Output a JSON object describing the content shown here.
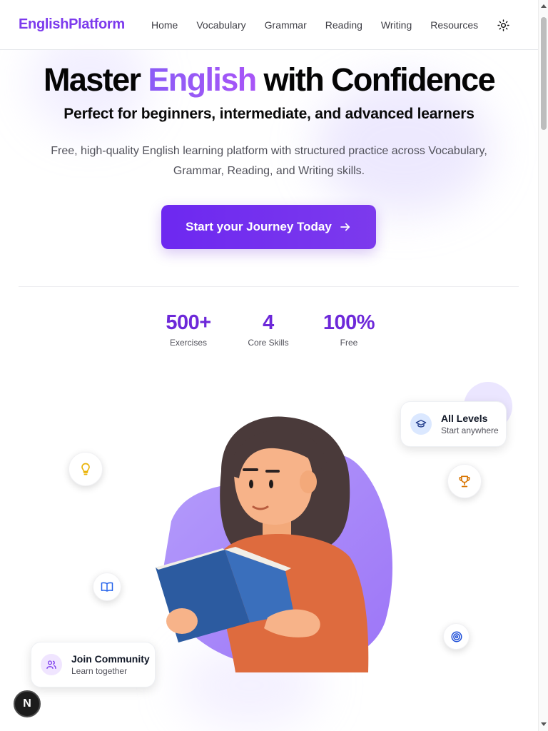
{
  "header": {
    "brand": "EnglishPlatform",
    "nav": [
      "Home",
      "Vocabulary",
      "Grammar",
      "Reading",
      "Writing",
      "Resources"
    ],
    "theme_toggle_icon": "sun-icon"
  },
  "hero": {
    "title_before": "Master ",
    "title_accent": "English",
    "title_after": " with Confidence",
    "subtitle": "Perfect for beginners, intermediate, and advanced learners",
    "description": "Free, high-quality English learning platform with structured practice across Vocabulary, Grammar, Reading, and Writing skills.",
    "cta_label": "Start your Journey Today"
  },
  "stats": [
    {
      "value": "500+",
      "label": "Exercises"
    },
    {
      "value": "4",
      "label": "Core Skills"
    },
    {
      "value": "100%",
      "label": "Free"
    }
  ],
  "floating_cards": {
    "levels": {
      "title": "All Levels",
      "subtitle": "Start anywhere",
      "icon": "graduation-cap-icon"
    },
    "community": {
      "title": "Join Community",
      "subtitle": "Learn together",
      "icon": "users-icon"
    }
  },
  "floating_icons": [
    "lightbulb-icon",
    "trophy-icon",
    "book-open-icon",
    "target-icon"
  ],
  "next_badge": "N",
  "colors": {
    "brand": "#7c3aed",
    "primary": "#6d28d9",
    "lightbulb": "#eab308",
    "trophy": "#d97706",
    "book": "#2563eb",
    "target": "#1d4ed8",
    "community": "#7c3aed"
  }
}
